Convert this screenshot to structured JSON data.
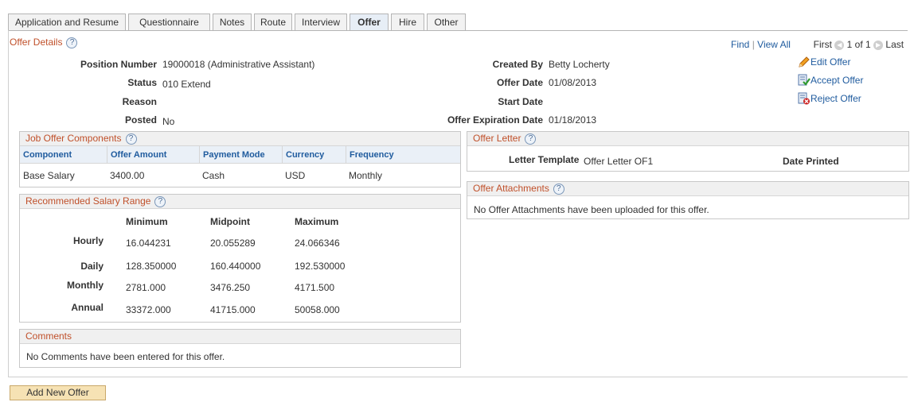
{
  "tabs": [
    "Application and Resume",
    "Questionnaire",
    "Notes",
    "Route",
    "Interview",
    "Offer",
    "Hire",
    "Other"
  ],
  "offer_details": {
    "title": "Offer Details",
    "nav": {
      "find": "Find",
      "sep": "|",
      "view_all": "View All",
      "first": "First",
      "range": "1 of 1",
      "last": "Last"
    },
    "position_number_label": "Position Number",
    "position_number": "19000018 (Administrative Assistant)",
    "status_label": "Status",
    "status": "010 Extend",
    "reason_label": "Reason",
    "posted_label": "Posted",
    "posted": "No",
    "created_by_label": "Created By",
    "created_by": "Betty Locherty",
    "offer_date_label": "Offer Date",
    "offer_date": "01/08/2013",
    "start_date_label": "Start Date",
    "expiration_label": "Offer Expiration Date",
    "expiration": "01/18/2013",
    "actions": {
      "edit": "Edit Offer",
      "accept": "Accept Offer",
      "reject": "Reject Offer"
    }
  },
  "job_offer_components": {
    "title": "Job Offer Components",
    "headers": [
      "Component",
      "Offer Amount",
      "Payment Mode",
      "Currency",
      "Frequency"
    ],
    "rows": [
      [
        "Base Salary",
        "3400.00",
        "Cash",
        "USD",
        "Monthly"
      ]
    ]
  },
  "salary_range": {
    "title": "Recommended Salary Range",
    "headers": [
      "Minimum",
      "Midpoint",
      "Maximum"
    ],
    "rows": [
      {
        "label": "Hourly",
        "values": [
          "16.044231",
          "20.055289",
          "24.066346"
        ]
      },
      {
        "label": "Daily",
        "values": [
          "128.350000",
          "160.440000",
          "192.530000"
        ]
      },
      {
        "label": "Monthly",
        "values": [
          "2781.000",
          "3476.250",
          "4171.500"
        ]
      },
      {
        "label": "Annual",
        "values": [
          "33372.000",
          "41715.000",
          "50058.000"
        ]
      }
    ]
  },
  "comments": {
    "title": "Comments",
    "text": "No Comments have been entered for this offer."
  },
  "offer_letter": {
    "title": "Offer Letter",
    "template_label": "Letter Template",
    "template": "Offer Letter OF1",
    "date_printed_label": "Date Printed"
  },
  "offer_attachments": {
    "title": "Offer Attachments",
    "text": "No Offer Attachments have been uploaded for this offer."
  },
  "add_button": "Add New Offer",
  "help_glyph": "?",
  "colors": {
    "section_title": "#c0502a",
    "link": "#1f5b9e",
    "button": "#f6e2b4"
  }
}
